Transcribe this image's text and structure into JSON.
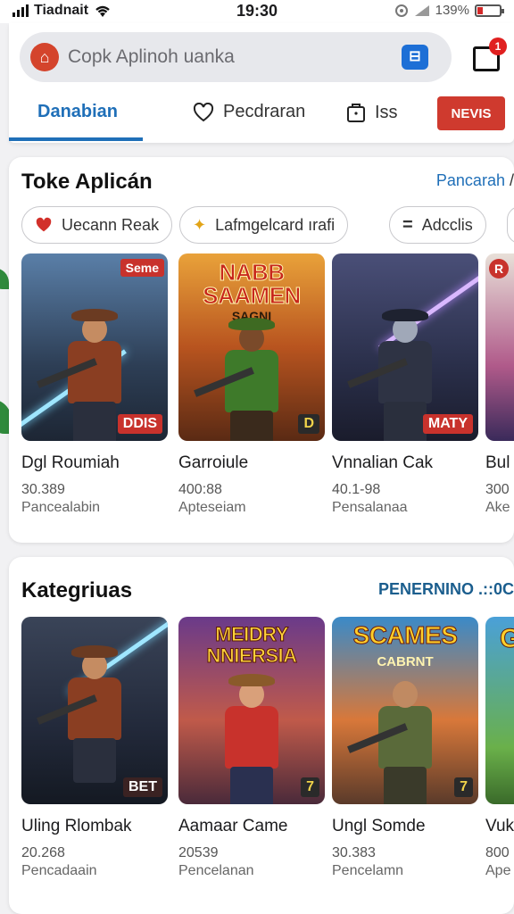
{
  "status_bar": {
    "carrier": "Tiadnait",
    "time": "19:30",
    "battery": "139%"
  },
  "search": {
    "placeholder": "Copk Aplinoh uanka"
  },
  "cart": {
    "badge": "1"
  },
  "tabs": [
    {
      "label": "Danabian",
      "icon": ""
    },
    {
      "label": "Pecdraran",
      "icon": "heart-icon"
    },
    {
      "label": "Iss",
      "icon": "bag-icon"
    }
  ],
  "news_button": "NEVIS",
  "section1": {
    "title": "Toke Aplicán",
    "link": "Pancarah",
    "link_suffix": "/",
    "chips": [
      {
        "label": "Uecann Reak",
        "icon": "heart-icon"
      },
      {
        "label": "Lafmgelcard ırafi",
        "icon": "sparkle-icon"
      },
      {
        "label": "Adcclis",
        "icon": "equals-icon"
      }
    ],
    "apps": [
      {
        "name": "Dgl Roumiah",
        "count": "30.389",
        "sub": "Pancealabin",
        "corner": "Seme",
        "tag": "DDIS"
      },
      {
        "name": "Garroiule",
        "count": "400:88",
        "sub": "Apteseiam",
        "banner": "NABB SAAMEN",
        "banner_sub": "SAGNI",
        "tag": "D"
      },
      {
        "name": "Vnnalian Cak",
        "count": "40.1-98",
        "sub": "Pensalanaa",
        "tag": "MATY"
      },
      {
        "name": "Bul",
        "count": "300",
        "sub": "Ake",
        "corner": "R"
      }
    ]
  },
  "section2": {
    "title": "Kategriuas",
    "link": "PENERNINO .::0C",
    "apps": [
      {
        "name": "Uling Rlombak",
        "count": "20.268",
        "sub": "Pencadaain",
        "tag": "BET"
      },
      {
        "name": "Aamaar Came",
        "count": "20539",
        "sub": "Pencelanan",
        "banner": "MEIDRY NNIERSIA",
        "tag": "7"
      },
      {
        "name": "Ungl Somde",
        "count": "30.383",
        "sub": "Pencelamn",
        "banner": "SCAMES",
        "banner_sub": "CABRNT",
        "tag": "7"
      },
      {
        "name": "Vuk",
        "count": "800",
        "sub": "Ape",
        "banner": "G"
      }
    ]
  },
  "colors": {
    "accent": "#1f6fb8",
    "badge_red": "#cf3a2e"
  }
}
